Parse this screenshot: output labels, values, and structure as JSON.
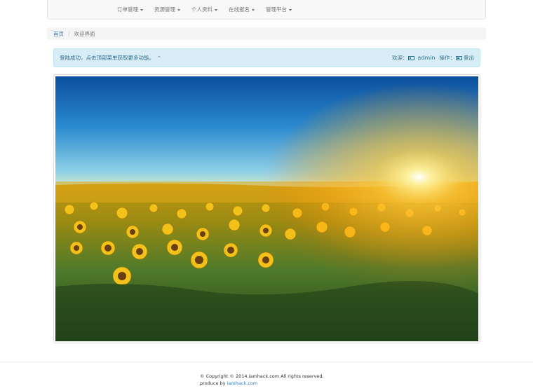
{
  "nav": {
    "items": [
      {
        "label": "订单管理"
      },
      {
        "label": "资源管理"
      },
      {
        "label": "个人资料"
      },
      {
        "label": "在线报名"
      },
      {
        "label": "管理平台"
      }
    ]
  },
  "breadcrumb": {
    "home": "首页",
    "separator": "/",
    "current": "欢迎界面"
  },
  "alert": {
    "message": "登陆成功，点击顶部菜单获取更多功能。",
    "up_icon": "chevron-up-icon",
    "welcome_label": "欢迎：",
    "username": "admin",
    "operation_label": "操作：",
    "logout_label": "登出",
    "user_icon": "user-card-icon",
    "logout_icon": "logout-icon"
  },
  "hero_image": {
    "subject": "sunflower-field-sunrise"
  },
  "footer": {
    "copyright": "© Copyright © 2014.iamhack.com All rights reserved.",
    "produce_label": "produce by",
    "produce_link": "iamhack.com"
  },
  "colors": {
    "link": "#337ab7",
    "alert_bg": "#d9edf7",
    "alert_text": "#31708f",
    "navbar_bg": "#f8f8f8"
  }
}
